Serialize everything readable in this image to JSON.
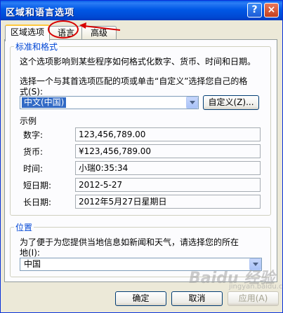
{
  "window": {
    "title": "区域和语言选项",
    "help": "?",
    "close": "×"
  },
  "tabs": [
    {
      "label": "区域选项",
      "active": true
    },
    {
      "label": "语言",
      "active": false
    },
    {
      "label": "高级",
      "active": false
    }
  ],
  "standards": {
    "legend": "标准和格式",
    "description": "这个选项影响到某些程序如何格式化数字、货币、时间和日期。",
    "instruction_line1": "选择一个与其首选项匹配的项或单击“自定义”选择您自己的格",
    "instruction_line2": "式(S):",
    "locale_value": "中文(中国)",
    "customize_button": "自定义(Z)...",
    "samples_title": "示例",
    "samples": [
      {
        "label": "数字:",
        "value": "123,456,789.00"
      },
      {
        "label": "货币:",
        "value": "¥123,456,789.00"
      },
      {
        "label": "时间:",
        "value": "小瑞0:35:34"
      },
      {
        "label": "短日期:",
        "value": "2012-5-27"
      },
      {
        "label": "长日期:",
        "value": "2012年5月27日星期日"
      }
    ]
  },
  "location": {
    "legend": "位置",
    "description_line1": "为了便于为您提供当地信息如新闻和天气，请选择您的所在",
    "description_line2": "地(I):",
    "value": "中国"
  },
  "footer": {
    "ok": "确定",
    "cancel": "取消",
    "apply": "应用(A)"
  },
  "watermark": {
    "main": "Baidu 经验",
    "sub": "jingyan.baidu.com"
  },
  "colors": {
    "titlebar": "#0058e6",
    "legend": "#0046d5",
    "selection": "#316ac5",
    "annotation": "#d80000"
  }
}
